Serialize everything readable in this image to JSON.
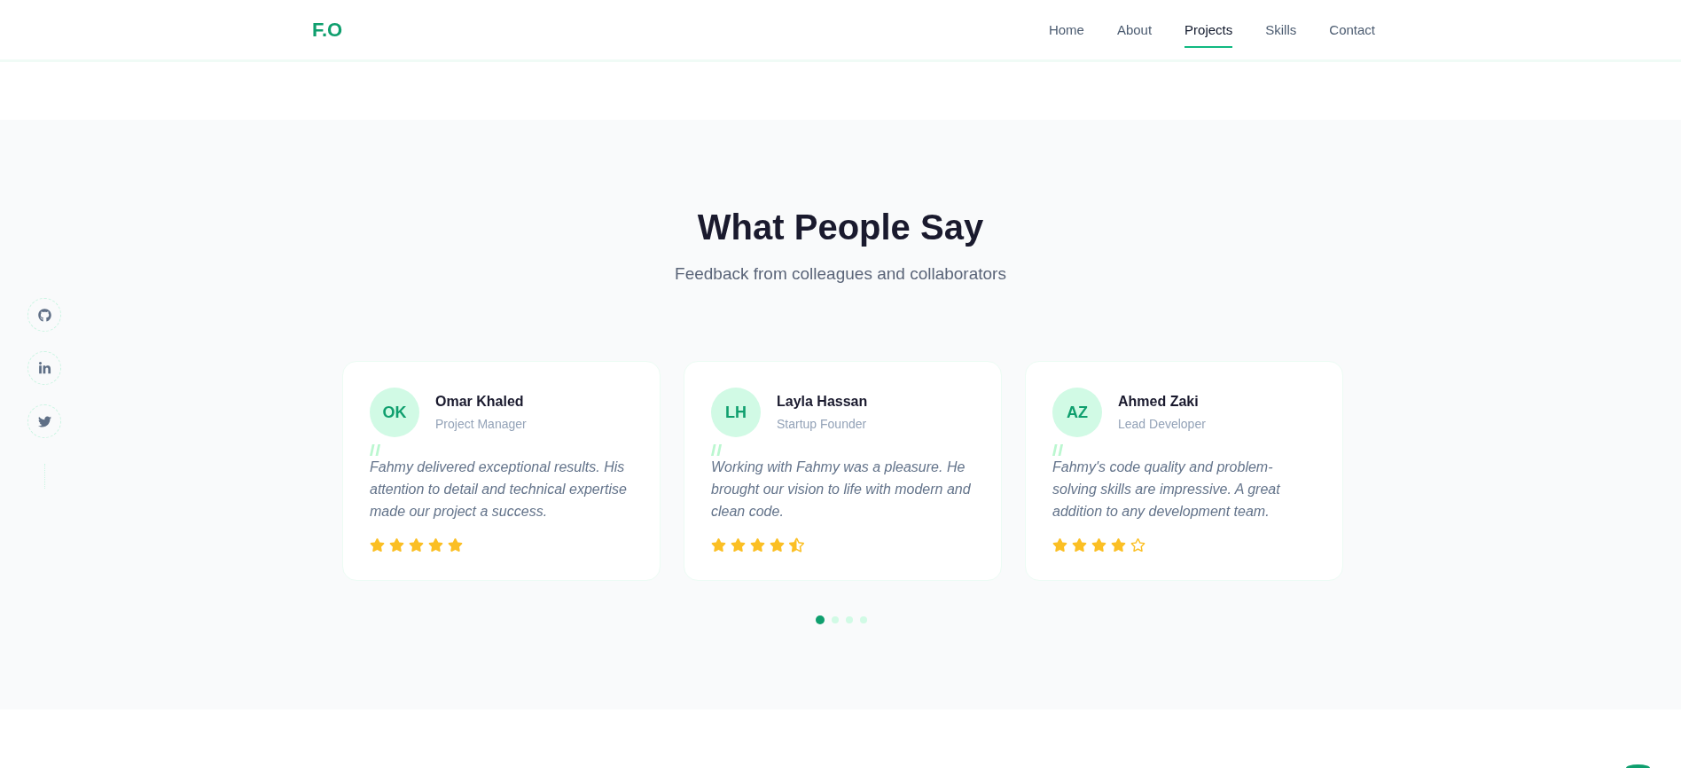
{
  "header": {
    "logo": "F.O",
    "nav": [
      {
        "label": "Home",
        "selected": false
      },
      {
        "label": "About",
        "selected": false
      },
      {
        "label": "Projects",
        "selected": true
      },
      {
        "label": "Skills",
        "selected": false
      },
      {
        "label": "Contact",
        "selected": false
      }
    ]
  },
  "testimonials": {
    "title": "What People Say",
    "subtitle": "Feedback from colleagues and collaborators",
    "cards": [
      {
        "initials": "OK",
        "name": "Omar Khaled",
        "role": "Project Manager",
        "quote": "Fahmy delivered exceptional results. His attention to detail and technical expertise made our project a success.",
        "stars": 5
      },
      {
        "initials": "LH",
        "name": "Layla Hassan",
        "role": "Startup Founder",
        "quote": "Working with Fahmy was a pleasure. He brought our vision to life with modern and clean code.",
        "stars": 4.5
      },
      {
        "initials": "AZ",
        "name": "Ahmed Zaki",
        "role": "Lead Developer",
        "quote": "Fahmy's code quality and problem-solving skills are impressive. A great addition to any development team.",
        "stars": 4
      }
    ],
    "pagination": [
      {
        "selected": true
      },
      {
        "selected": false
      },
      {
        "selected": false
      },
      {
        "selected": false
      }
    ]
  }
}
